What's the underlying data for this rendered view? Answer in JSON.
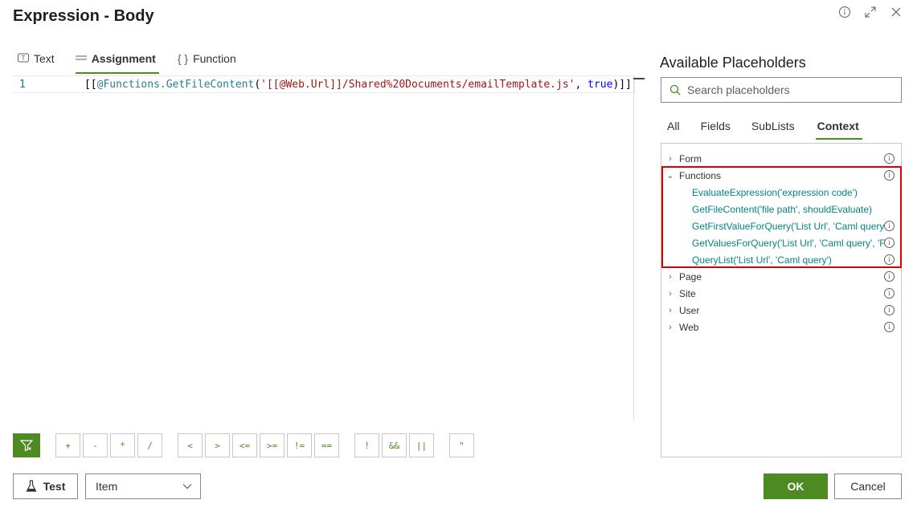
{
  "dialog": {
    "title": "Expression - Body"
  },
  "editor_tabs": [
    "Text",
    "Assignment",
    "Function"
  ],
  "editor": {
    "line_number": "1",
    "code_tokens": [
      {
        "text": "[[",
        "kind": "plain"
      },
      {
        "text": "@Functions",
        "kind": "plain"
      },
      {
        "text": ".GetFileContent",
        "kind": "id"
      },
      {
        "text": "(",
        "kind": "plain"
      },
      {
        "text": "'[[@Web.Url]]/Shared%20Documents/emailTemplate.js'",
        "kind": "str"
      },
      {
        "text": ", ",
        "kind": "plain"
      },
      {
        "text": "true",
        "kind": "kw"
      },
      {
        "text": ")]]",
        "kind": "plain"
      }
    ]
  },
  "operators": [
    "+",
    "-",
    "*",
    "/",
    "<",
    ">",
    "<=",
    ">=",
    "!=",
    "==",
    "!",
    "&&",
    "||",
    "\""
  ],
  "test_button_label": "Test",
  "scope_select_value": "Item",
  "placeholders": {
    "title": "Available Placeholders",
    "search_placeholder": "Search placeholders",
    "tabs": [
      "All",
      "Fields",
      "SubLists",
      "Context"
    ],
    "active_tab": "Context",
    "tree": [
      {
        "label": "Form",
        "expanded": false
      },
      {
        "label": "Functions",
        "expanded": true,
        "children": [
          {
            "label": "EvaluateExpression('expression code')",
            "info": false
          },
          {
            "label": "GetFileContent('file path', shouldEvaluate)",
            "info": false
          },
          {
            "label": "GetFirstValueForQuery('List Url', 'Caml query')",
            "info": true
          },
          {
            "label": "GetValuesForQuery('List Url', 'Caml query', 'Field')",
            "info": true
          },
          {
            "label": "QueryList('List Url', 'Caml query')",
            "info": true
          }
        ]
      },
      {
        "label": "Page",
        "expanded": false
      },
      {
        "label": "Site",
        "expanded": false
      },
      {
        "label": "User",
        "expanded": false
      },
      {
        "label": "Web",
        "expanded": false
      }
    ]
  },
  "footer": {
    "ok_label": "OK",
    "cancel_label": "Cancel"
  },
  "colors": {
    "accent": "#4d8a21",
    "link": "#038387",
    "highlight_border": "#e00000"
  }
}
